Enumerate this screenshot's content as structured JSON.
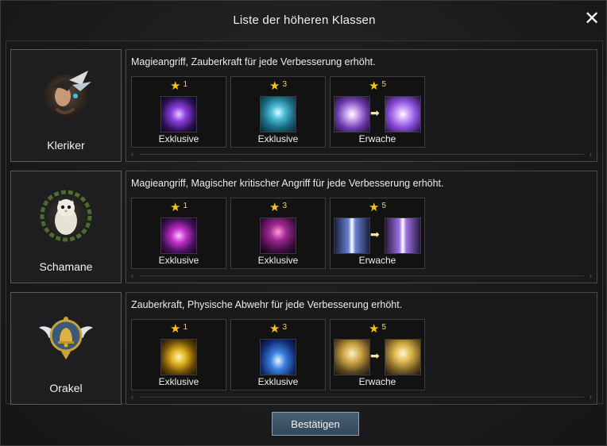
{
  "dialog": {
    "title": "Liste der höheren Klassen",
    "close_symbol": "✕",
    "confirm_label": "Bestätigen"
  },
  "icons": {
    "star": "star-icon",
    "close": "close-icon",
    "arrow": "arrow-right-icon"
  },
  "colors": {
    "star": "#f7c21a",
    "button_bg": "#3e5167",
    "card_border": "#5a5a5c"
  },
  "classes": [
    {
      "name": "Kleriker",
      "emblem": "cleric-portrait-icon",
      "description": "Magieangriff, Zauberkraft für jede Verbesserung erhöht.",
      "slots": [
        {
          "stars": "1",
          "label": "Exklusive",
          "icons": [
            "purple-orb-skill-icon"
          ]
        },
        {
          "stars": "3",
          "label": "Exklusive",
          "icons": [
            "blue-aura-skill-icon"
          ]
        },
        {
          "stars": "5",
          "label": "Erwache",
          "icons": [
            "violet-burst-skill-icon",
            "violet-star-burst-skill-icon"
          ]
        }
      ]
    },
    {
      "name": "Schamane",
      "emblem": "owl-emblem-icon",
      "description": "Magieangriff, Magischer kritischer Angriff für jede Verbesserung erhöht.",
      "slots": [
        {
          "stars": "1",
          "label": "Exklusive",
          "icons": [
            "magenta-rune-skill-icon"
          ]
        },
        {
          "stars": "3",
          "label": "Exklusive",
          "icons": [
            "magenta-spirit-skill-icon"
          ]
        },
        {
          "stars": "5",
          "label": "Erwache",
          "icons": [
            "light-beam-skill-icon",
            "light-beam-violet-skill-icon"
          ]
        }
      ]
    },
    {
      "name": "Orakel",
      "emblem": "winged-bell-emblem-icon",
      "description": "Zauberkraft, Physische Abwehr für jede Verbesserung erhöht.",
      "slots": [
        {
          "stars": "1",
          "label": "Exklusive",
          "icons": [
            "golden-sphere-skill-icon"
          ]
        },
        {
          "stars": "3",
          "label": "Exklusive",
          "icons": [
            "blue-pillar-skill-icon"
          ]
        },
        {
          "stars": "5",
          "label": "Erwache",
          "icons": [
            "golden-warrior-skill-icon",
            "golden-warrior-glow-skill-icon"
          ]
        }
      ]
    }
  ]
}
